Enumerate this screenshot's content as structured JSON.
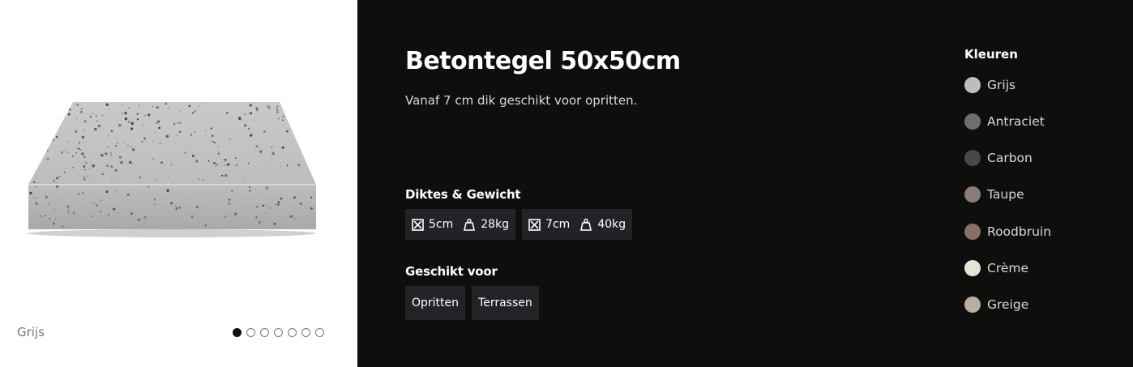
{
  "gallery": {
    "variant_label": "Grijs",
    "slide_count": 7,
    "active_slide": 1
  },
  "product": {
    "title": "Betontegel 50x50cm",
    "subtitle": "Vanaf 7 cm dik geschikt voor opritten."
  },
  "specs": {
    "heading": "Diktes & Gewicht",
    "items": [
      {
        "thickness": "5cm",
        "weight": "28kg"
      },
      {
        "thickness": "7cm",
        "weight": "40kg"
      }
    ],
    "thickness_icon": "expand-icon",
    "weight_icon": "weight-icon"
  },
  "usage": {
    "heading": "Geschikt voor",
    "items": [
      "Opritten",
      "Terrassen"
    ]
  },
  "colors": {
    "heading": "Kleuren",
    "items": [
      {
        "name": "Grijs",
        "hex": "#bdbdbd"
      },
      {
        "name": "Antraciet",
        "hex": "#6f6e6c"
      },
      {
        "name": "Carbon",
        "hex": "#474746"
      },
      {
        "name": "Taupe",
        "hex": "#8a7c78"
      },
      {
        "name": "Roodbruin",
        "hex": "#8a6e67"
      },
      {
        "name": "Crème",
        "hex": "#e7e3d6"
      },
      {
        "name": "Greige",
        "hex": "#b8afa2"
      }
    ]
  },
  "theme": {
    "panel_bg": "#0e0e0d",
    "chip_bg": "#222326"
  }
}
